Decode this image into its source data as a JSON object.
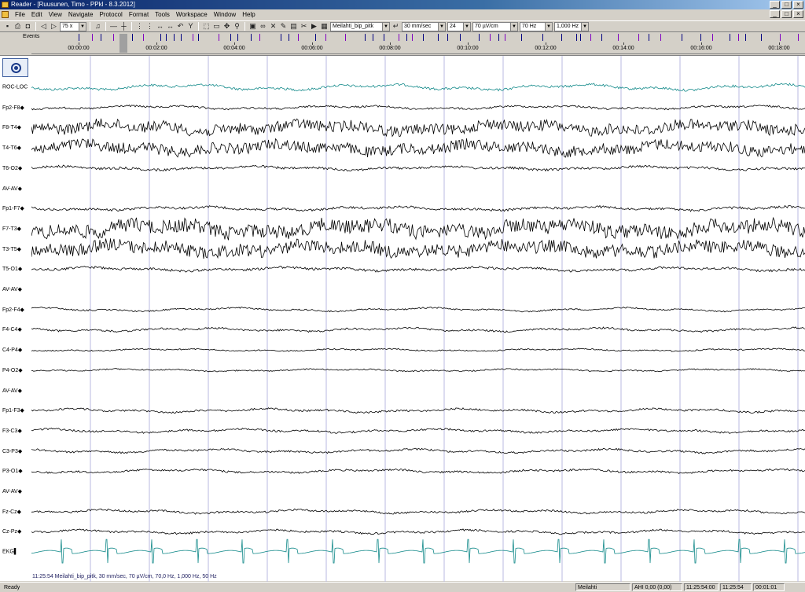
{
  "window": {
    "title": "Reader - [Ruusunen, Timo - PPkl - 8.3.2012]",
    "buttons": [
      "_",
      "□",
      "×"
    ]
  },
  "menu": [
    "File",
    "Edit",
    "View",
    "Navigate",
    "Protocol",
    "Format",
    "Tools",
    "Workspace",
    "Window",
    "Help"
  ],
  "toolbar": {
    "zoom": "75 x",
    "montage": "Meilahti_bip_pitk",
    "speed": "30 mm/sec",
    "channels": "24",
    "sensitivity": "70 µV/cm",
    "lowpass": "70 Hz",
    "sampling": "1,000 Hz"
  },
  "events": {
    "label": "Events",
    "colors": {
      "normal": "#000080",
      "special": "#8000c0"
    }
  },
  "timeline": [
    "00:00:00",
    "00:02:00",
    "00:04:00",
    "00:06:00",
    "00:08:00",
    "00:10:00",
    "00:12:00",
    "00:14:00",
    "00:16:00",
    "00:18:00"
  ],
  "channels": [
    {
      "label": "ROC-LOC",
      "color": "#138a8a",
      "amp": 5,
      "hf": 0.3
    },
    {
      "label": "Fp2-F8◆",
      "color": "#000000",
      "amp": 3,
      "hf": 0.4
    },
    {
      "label": "F8-T4◆",
      "color": "#000000",
      "amp": 7,
      "hf": 1.0
    },
    {
      "label": "T4-T6◆",
      "color": "#000000",
      "amp": 7,
      "hf": 1.0
    },
    {
      "label": "T6-O2◆",
      "color": "#000000",
      "amp": 3,
      "hf": 0.5
    },
    {
      "label": "AV-AV◆",
      "color": "#000000",
      "amp": 0,
      "hf": 0
    },
    {
      "label": "Fp1-F7◆",
      "color": "#000000",
      "amp": 3,
      "hf": 0.5
    },
    {
      "label": "F7-T3◆",
      "color": "#000000",
      "amp": 9,
      "hf": 1.0
    },
    {
      "label": "T3-T5◆",
      "color": "#000000",
      "amp": 8,
      "hf": 1.0
    },
    {
      "label": "T5-O1◆",
      "color": "#000000",
      "amp": 3,
      "hf": 0.5
    },
    {
      "label": "AV-AV◆",
      "color": "#000000",
      "amp": 0,
      "hf": 0
    },
    {
      "label": "Fp2-F4◆",
      "color": "#000000",
      "amp": 3,
      "hf": 0.3
    },
    {
      "label": "F4-C4◆",
      "color": "#000000",
      "amp": 3,
      "hf": 0.4
    },
    {
      "label": "C4-P4◆",
      "color": "#000000",
      "amp": 2,
      "hf": 0.4
    },
    {
      "label": "P4-O2◆",
      "color": "#000000",
      "amp": 2,
      "hf": 0.4
    },
    {
      "label": "AV-AV◆",
      "color": "#000000",
      "amp": 0,
      "hf": 0
    },
    {
      "label": "Fp1-F3◆",
      "color": "#000000",
      "amp": 3,
      "hf": 0.4
    },
    {
      "label": "F3-C3◆",
      "color": "#000000",
      "amp": 3,
      "hf": 0.4
    },
    {
      "label": "C3-P3◆",
      "color": "#000000",
      "amp": 3,
      "hf": 0.4
    },
    {
      "label": "P3-O1◆",
      "color": "#000000",
      "amp": 3,
      "hf": 0.4
    },
    {
      "label": "AV-AV◆",
      "color": "#000000",
      "amp": 0,
      "hf": 0
    },
    {
      "label": "Fz-Cz◆",
      "color": "#000000",
      "amp": 3,
      "hf": 0.4
    },
    {
      "label": "Cz-Pz◆",
      "color": "#000000",
      "amp": 3,
      "hf": 0.4
    },
    {
      "label": "EKG▌",
      "color": "#138a8a",
      "amp": 0,
      "hf": 0,
      "ekg": true
    }
  ],
  "info_line": "11:25:54 Meilahti_bip_pitk, 30 mm/sec, 70 µV/cm, 70,0 Hz, 1,000 Hz, 50 Hz",
  "status": {
    "ready": "Ready",
    "site": "Meilahti",
    "ahi": "AHI 0,00 (0,00)",
    "start": "11:25:54:00",
    "time": "11:25:54",
    "duration": "00:01:01"
  }
}
